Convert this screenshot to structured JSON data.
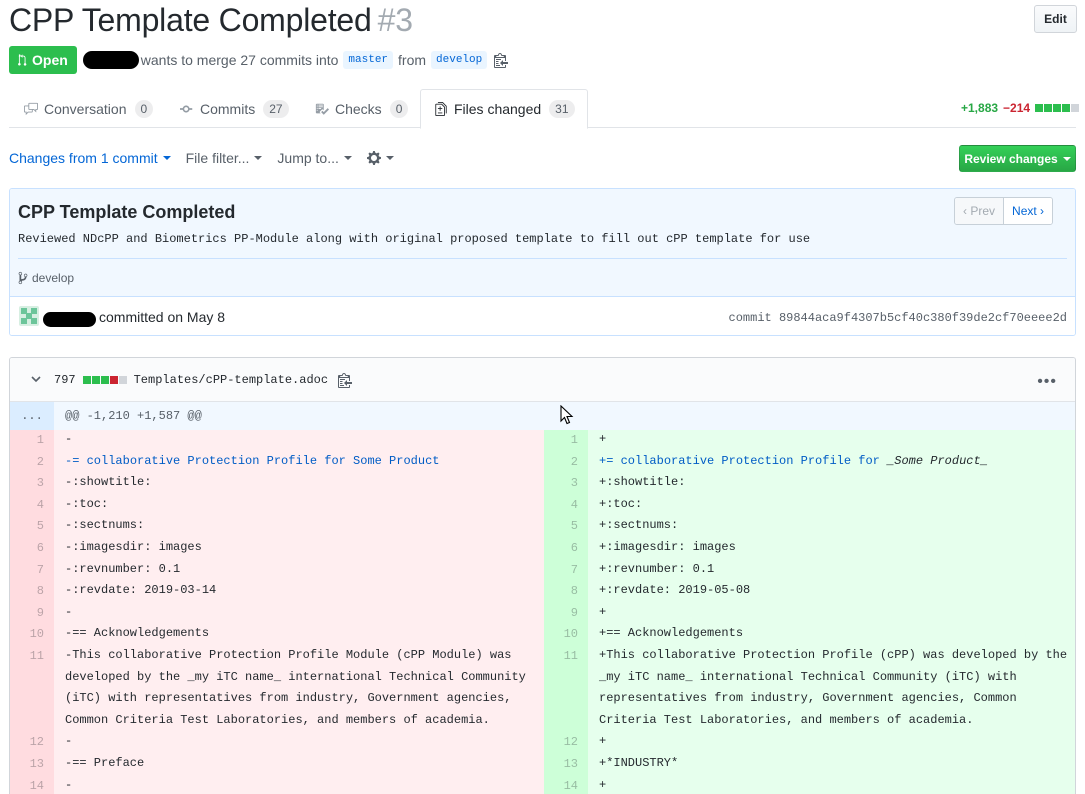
{
  "pr": {
    "title": "CPP Template Completed",
    "number": "#3",
    "edit_label": "Edit",
    "state": "Open",
    "merge_text": "wants to merge 27 commits into",
    "base_branch": "master",
    "from_text": "from",
    "head_branch": "develop"
  },
  "tabs": [
    {
      "label": "Conversation",
      "count": "0"
    },
    {
      "label": "Commits",
      "count": "27"
    },
    {
      "label": "Checks",
      "count": "0"
    },
    {
      "label": "Files changed",
      "count": "31"
    }
  ],
  "diffstat": {
    "additions": "+1,883",
    "deletions": "−214"
  },
  "toolbar": {
    "changes_from": "Changes from",
    "changes_link": "1 commit",
    "file_filter": "File filter...",
    "jump_to": "Jump to...",
    "review_label": "Review changes"
  },
  "commit": {
    "title": "CPP Template Completed",
    "description": "Reviewed NDcPP and Biometrics PP-Module along with original proposed template to fill out cPP template for use",
    "branch": "develop",
    "prev_label": "Prev",
    "next_label": "Next",
    "committed_text": "committed on May 8",
    "sha": "commit 89844aca9f4307b5cf40c380f39de2cf70eeee2d"
  },
  "file": {
    "changes": "797",
    "path": "Templates/cPP-template.adoc",
    "hunk_expand": "...",
    "hunk_header": "@@ -1,210 +1,587 @@"
  },
  "diff": {
    "left": [
      {
        "n": "1",
        "lines": [
          "-"
        ]
      },
      {
        "n": "2",
        "lines": [
          "-= collaborative Protection Profile for Some Product"
        ]
      },
      {
        "n": "3",
        "lines": [
          "-:showtitle:"
        ]
      },
      {
        "n": "4",
        "lines": [
          "-:toc:"
        ]
      },
      {
        "n": "5",
        "lines": [
          "-:sectnums:"
        ]
      },
      {
        "n": "6",
        "lines": [
          "-:imagesdir: images"
        ]
      },
      {
        "n": "7",
        "lines": [
          "-:revnumber: 0.1"
        ]
      },
      {
        "n": "8",
        "lines": [
          "-:revdate: 2019-03-14"
        ]
      },
      {
        "n": "9",
        "lines": [
          "-"
        ]
      },
      {
        "n": "10",
        "lines": [
          "-== Acknowledgements"
        ]
      },
      {
        "n": "11",
        "lines": [
          "-This collaborative Protection Profile Module (cPP Module) was",
          " developed by the _my iTC name_ international Technical Community",
          " (iTC) with representatives from industry, Government agencies,",
          " Common Criteria Test Laboratories, and members of academia."
        ]
      },
      {
        "n": "12",
        "lines": [
          "-"
        ]
      },
      {
        "n": "13",
        "lines": [
          "-== Preface"
        ]
      },
      {
        "n": "14",
        "lines": [
          "-"
        ]
      }
    ],
    "right": [
      {
        "n": "1",
        "lines": [
          "+"
        ]
      },
      {
        "n": "2",
        "lines": [
          "+= collaborative Protection Profile for _Some Product_"
        ]
      },
      {
        "n": "3",
        "lines": [
          "+:showtitle:"
        ]
      },
      {
        "n": "4",
        "lines": [
          "+:toc:"
        ]
      },
      {
        "n": "5",
        "lines": [
          "+:sectnums:"
        ]
      },
      {
        "n": "6",
        "lines": [
          "+:imagesdir: images"
        ]
      },
      {
        "n": "7",
        "lines": [
          "+:revnumber: 0.1"
        ]
      },
      {
        "n": "8",
        "lines": [
          "+:revdate: 2019-05-08"
        ]
      },
      {
        "n": "9",
        "lines": [
          "+"
        ]
      },
      {
        "n": "10",
        "lines": [
          "+== Acknowledgements"
        ]
      },
      {
        "n": "11",
        "lines": [
          "+This collaborative Protection Profile (cPP) was developed by the",
          " _my iTC name_ international Technical Community (iTC) with",
          " representatives from industry, Government agencies, Common",
          " Criteria Test Laboratories, and members of academia."
        ]
      },
      {
        "n": "12",
        "lines": [
          "+"
        ]
      },
      {
        "n": "13",
        "lines": [
          "+*INDUSTRY*"
        ]
      },
      {
        "n": "14",
        "lines": [
          "+"
        ]
      }
    ]
  },
  "colors": {
    "open": "#2cbe4e",
    "link": "#0366d6",
    "del_bg": "#ffeef0",
    "add_bg": "#e6ffed"
  },
  "icons": [
    "merge-icon",
    "clipboard-icon",
    "comment-icon",
    "commit-icon",
    "checklist-icon",
    "file-diff-icon",
    "gear-icon",
    "branch-icon",
    "chevron-down-icon",
    "kebab-icon",
    "cursor-icon"
  ]
}
